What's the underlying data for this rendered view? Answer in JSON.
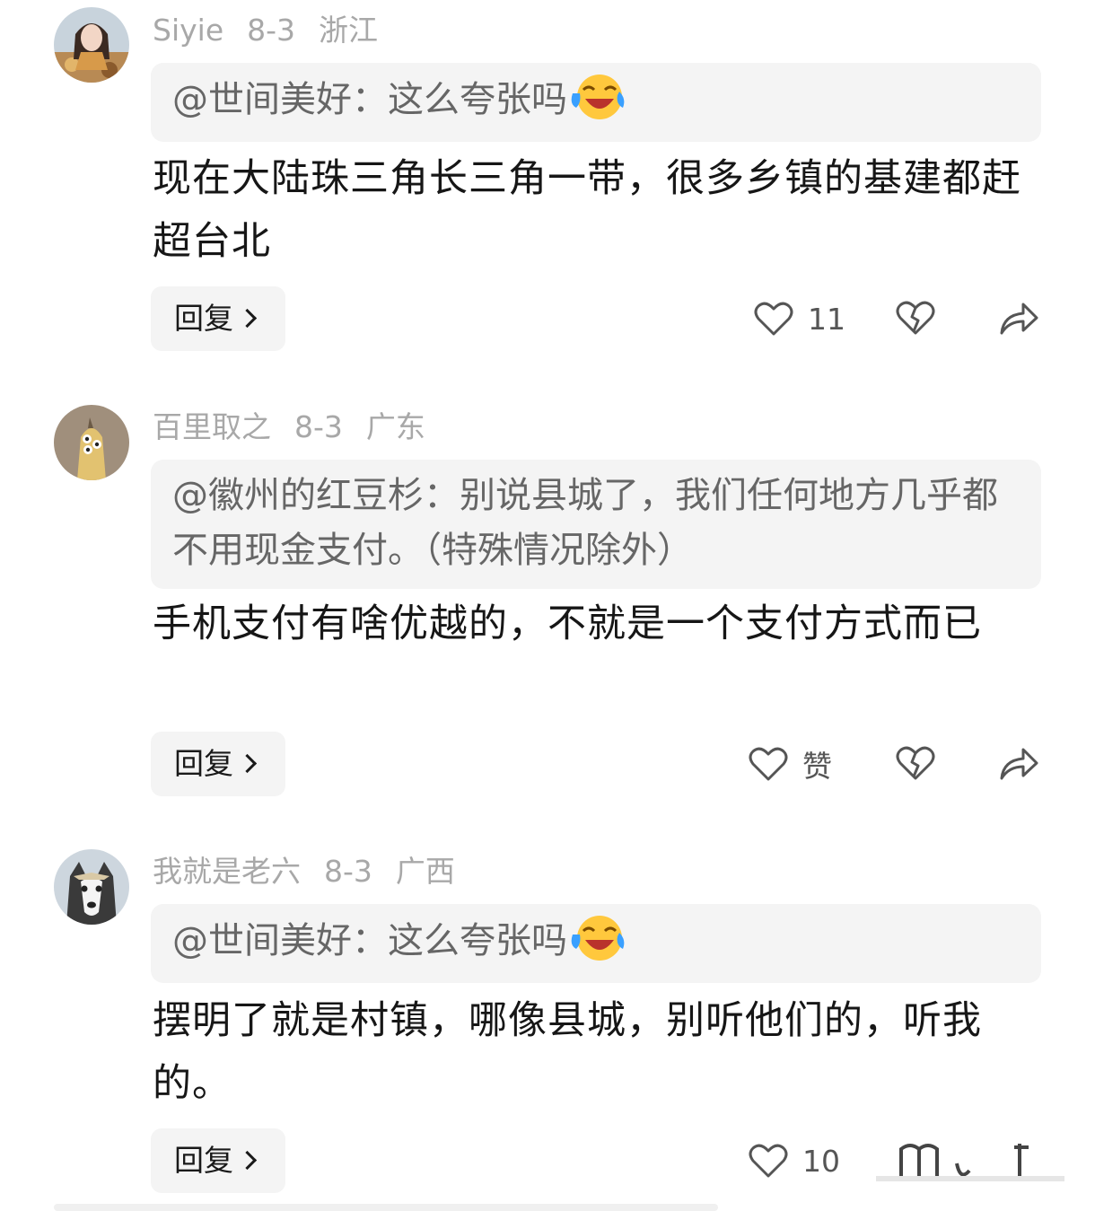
{
  "comments": [
    {
      "author": "Siyie",
      "date": "8-3",
      "location": "浙江",
      "quote": "@世间美好：这么夸张吗",
      "quote_emoji": "laughing-tears-emoji",
      "text": "现在大陆珠三角长三角一带，很多乡镇的基建都赶超台北",
      "reply_label": "回复",
      "like_count": "11"
    },
    {
      "author": "百里取之",
      "date": "8-3",
      "location": "广东",
      "quote": "@徽州的红豆杉：别说县城了，我们任何地方几乎都不用现金支付。（特殊情况除外）",
      "quote_emoji": "",
      "text": "手机支付有啥优越的，不就是一个支付方式而已",
      "reply_label": "回复",
      "like_count": "赞"
    },
    {
      "author": "我就是老六",
      "date": "8-3",
      "location": "广西",
      "quote": "@世间美好：这么夸张吗",
      "quote_emoji": "laughing-tears-emoji",
      "text": "摆明了就是村镇，哪像县城，别听他们的，听我的。",
      "reply_label": "回复",
      "like_count": "10"
    }
  ],
  "icons": {
    "like": "heart-outline-icon",
    "dislike": "broken-heart-icon",
    "share": "share-arrow-icon",
    "reply_chevron": "chevron-right-icon"
  },
  "colors": {
    "meta_text": "#a8a8a8",
    "quote_bg": "#f4f4f4",
    "quote_text": "#666666",
    "body_text": "#161616"
  }
}
